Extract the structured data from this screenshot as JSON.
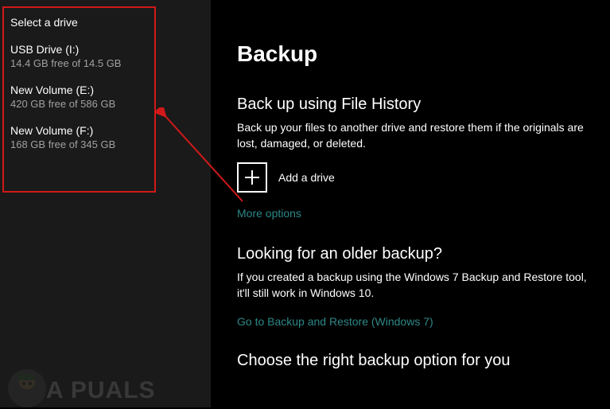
{
  "flyout": {
    "heading": "Select a drive",
    "drives": [
      {
        "name": "USB Drive (I:)",
        "space": "14.4 GB free of 14.5 GB"
      },
      {
        "name": "New Volume (E:)",
        "space": "420 GB free of 586 GB"
      },
      {
        "name": "New Volume (F:)",
        "space": "168 GB free of 345 GB"
      }
    ]
  },
  "page_title": "Backup",
  "file_history": {
    "title": "Back up using File History",
    "desc": "Back up your files to another drive and restore them if the originals are lost, damaged, or deleted.",
    "add_drive_label": "Add a drive",
    "more_options": "More options"
  },
  "older_backup": {
    "title": "Looking for an older backup?",
    "desc": "If you created a backup using the Windows 7 Backup and Restore tool, it'll still work in Windows 10.",
    "link": "Go to Backup and Restore (Windows 7)"
  },
  "choose_option": {
    "title": "Choose the right backup option for you"
  },
  "watermark_text": "A  PUALS"
}
